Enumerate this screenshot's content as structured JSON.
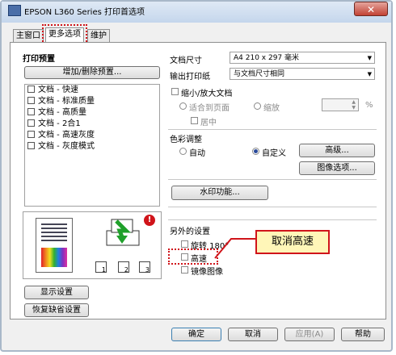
{
  "window": {
    "title": "EPSON L360 Series 打印首选项",
    "close_glyph": "✕"
  },
  "tabs": [
    {
      "label": "主窗口"
    },
    {
      "label": "更多选项"
    },
    {
      "label": "维护"
    }
  ],
  "left": {
    "section_title": "打印预置",
    "add_remove_button": "增加/删除预置...",
    "presets": [
      {
        "label": "文档 - 快速"
      },
      {
        "label": "文档 - 标准质量"
      },
      {
        "label": "文档 - 高质量"
      },
      {
        "label": "文档 - 2合1"
      },
      {
        "label": "文档 - 高速灰度"
      },
      {
        "label": "文档 - 灰度模式"
      }
    ],
    "warning_glyph": "!",
    "copy_icons": [
      "1",
      "2",
      "3"
    ],
    "show_settings_button": "显示设置",
    "restore_defaults_button": "恢复缺省设置"
  },
  "right": {
    "doc_size_label": "文档尺寸",
    "doc_size_value": "A4 210 x 297 毫米",
    "output_paper_label": "输出打印纸",
    "output_paper_value": "与文档尺寸相同",
    "reduce_enlarge_label": "缩小/放大文档",
    "fit_to_page_label": "适合到页面",
    "zoom_label": "缩放",
    "percent": "%",
    "center_label": "居中",
    "color_adjust_label": "色彩调整",
    "auto_label": "自动",
    "custom_label": "自定义",
    "advanced_button": "高级...",
    "image_options_button": "图像选项...",
    "watermark_button": "水印功能...",
    "extra_settings_label": "另外的设置",
    "rotate_label": "旋转 180°",
    "high_speed_label": "高速",
    "mirror_label": "镜像图像",
    "callout_text": "取消高速"
  },
  "footer": {
    "ok": "确定",
    "cancel": "取消",
    "apply": "应用(A)",
    "help": "帮助"
  },
  "colors": {
    "accent_red": "#d0141a",
    "callout_bg": "#fff6b8"
  }
}
